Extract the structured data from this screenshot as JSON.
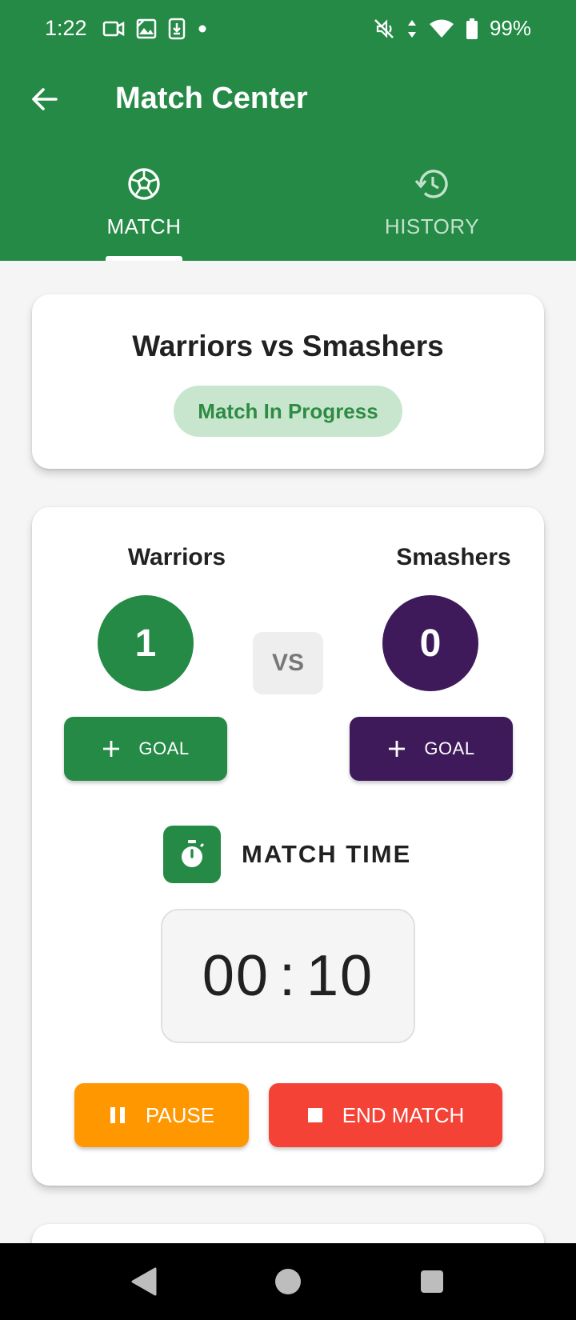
{
  "status_bar": {
    "time": "1:22",
    "battery": "99%",
    "icons": [
      "video-camera-icon",
      "image-icon",
      "download-icon",
      "dot-icon",
      "mute-icon",
      "data-arrows-icon",
      "wifi-icon",
      "battery-icon"
    ]
  },
  "toolbar": {
    "title": "Match Center",
    "back_icon": "arrow-back-icon"
  },
  "tabs": [
    {
      "label": "MATCH",
      "icon": "soccer-ball-icon",
      "active": true
    },
    {
      "label": "HISTORY",
      "icon": "history-icon",
      "active": false
    }
  ],
  "match_card": {
    "title": "Warriors vs Smashers",
    "status": "Match In Progress"
  },
  "score_card": {
    "team_a": {
      "name": "Warriors",
      "score": "1",
      "color": "#258a46"
    },
    "team_b": {
      "name": "Smashers",
      "score": "0",
      "color": "#3e1a5a"
    },
    "vs": "VS",
    "goal_label": "GOAL",
    "timer": {
      "label": "MATCH TIME",
      "minutes": "00",
      "seconds": "10",
      "separator": ":"
    },
    "pause_label": "PAUSE",
    "end_label": "END MATCH"
  },
  "colors": {
    "primary": "#258a46",
    "secondary": "#3e1a5a",
    "pause": "#ff9800",
    "end": "#f44336",
    "pill_bg": "#c8e6cd"
  }
}
